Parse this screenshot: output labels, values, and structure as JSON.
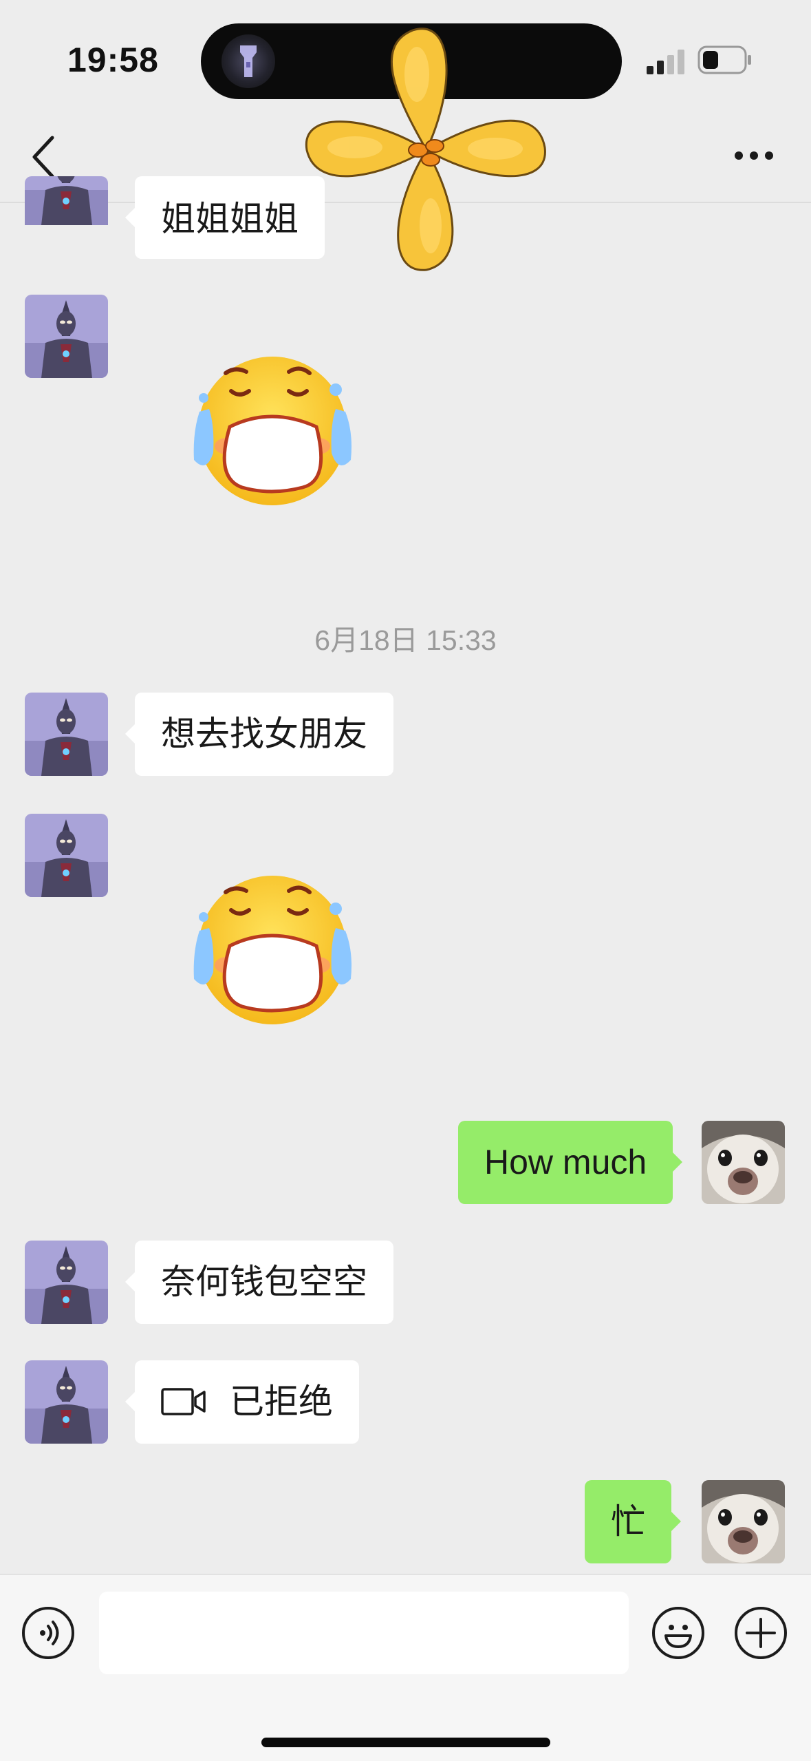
{
  "status_bar": {
    "time": "19:58"
  },
  "chat": {
    "timestamp": "6月18日 15:33",
    "messages": [
      {
        "from": "contact",
        "type": "text",
        "text": "姐姐姐姐"
      },
      {
        "from": "contact",
        "type": "sticker",
        "sticker": "crying-face"
      },
      {
        "from": "contact",
        "type": "text",
        "text": "想去找女朋友"
      },
      {
        "from": "contact",
        "type": "sticker",
        "sticker": "crying-face"
      },
      {
        "from": "me",
        "type": "text",
        "text": "How much"
      },
      {
        "from": "contact",
        "type": "text",
        "text": "奈何钱包空空"
      },
      {
        "from": "contact",
        "type": "video_call",
        "text": "已拒绝"
      },
      {
        "from": "me",
        "type": "text",
        "text": "忙"
      }
    ]
  },
  "input_bar": {
    "value": "",
    "placeholder": ""
  },
  "colors": {
    "background": "#ededed",
    "incoming_bubble": "#ffffff",
    "outgoing_bubble": "#95ec69",
    "timestamp": "#9a9a9a"
  },
  "icons": [
    "flashlight-icon",
    "signal-icon",
    "battery-icon",
    "back-icon",
    "more-icon",
    "video-call-icon",
    "voice-icon",
    "emoji-icon",
    "plus-icon"
  ]
}
